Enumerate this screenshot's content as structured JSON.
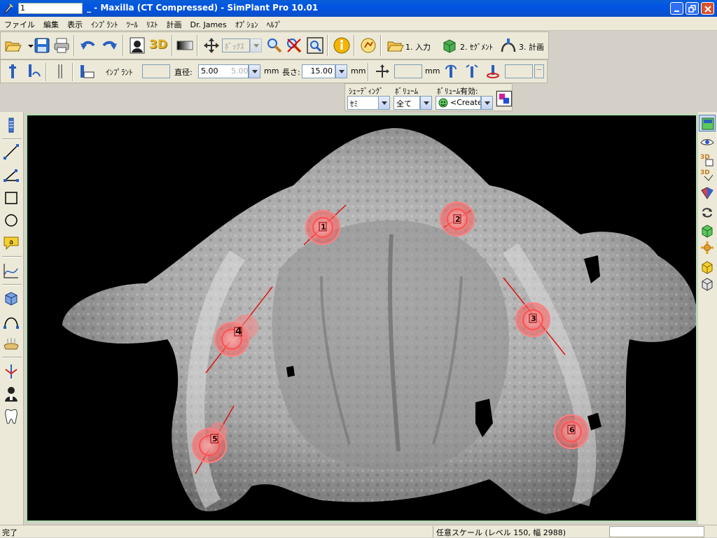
{
  "window": {
    "title": "_ - Maxilla (CT Compressed) - SimPlant Pro  10.01",
    "doc_prefix": "1"
  },
  "menu": [
    "ファイル",
    "編集",
    "表示",
    "ｲﾝﾌﾟﾗﾝﾄ",
    "ﾂｰﾙ",
    "ﾘｽﾄ",
    "計画",
    "Dr. James",
    "ｵﾌﾟｼｮﾝ",
    "ﾍﾙﾌﾟ"
  ],
  "toolbar1": {
    "label_3d": "3D",
    "view_mode_value": "ﾎﾞｯｸｽ",
    "steps": [
      "1. 入力",
      "2. ｾｸﾞﾒﾝﾄ",
      "3. 計画"
    ]
  },
  "toolbar2": {
    "implant_label": "ｲﾝﾌﾟﾗﾝﾄ",
    "diameter_label": "直径:",
    "diameter_value": "5.00",
    "diameter_value2": "5.00",
    "diameter_unit": "mm",
    "length_label": "長さ:",
    "length_value": "15.00",
    "length_unit": "mm",
    "offset_unit": "mm"
  },
  "toolbar3": {
    "shading_label": "ｼｪｰﾃﾞｨﾝｸﾞ",
    "shading_value": "ｾﾐ",
    "volume_label": "ﾎﾞﾘｭｰﾑ",
    "volume_value": "全て",
    "volume_enabled_label": "ﾎﾞﾘｭｰﾑ有効:",
    "volume_enabled_value": "<Create"
  },
  "implants": [
    {
      "label": "1"
    },
    {
      "label": "2"
    },
    {
      "label": "3"
    },
    {
      "label": "4"
    },
    {
      "label": "5"
    },
    {
      "label": "6"
    }
  ],
  "status": {
    "left": "完了",
    "scale": "任意スケール (レベル 150, 幅 2988)"
  },
  "colors": {
    "titlebar": "#0054e3",
    "chrome": "#ece9d8",
    "viewport_border": "#b0e0b0",
    "implant_ring": "#ff6a6a",
    "implant_axis": "#e01010"
  }
}
